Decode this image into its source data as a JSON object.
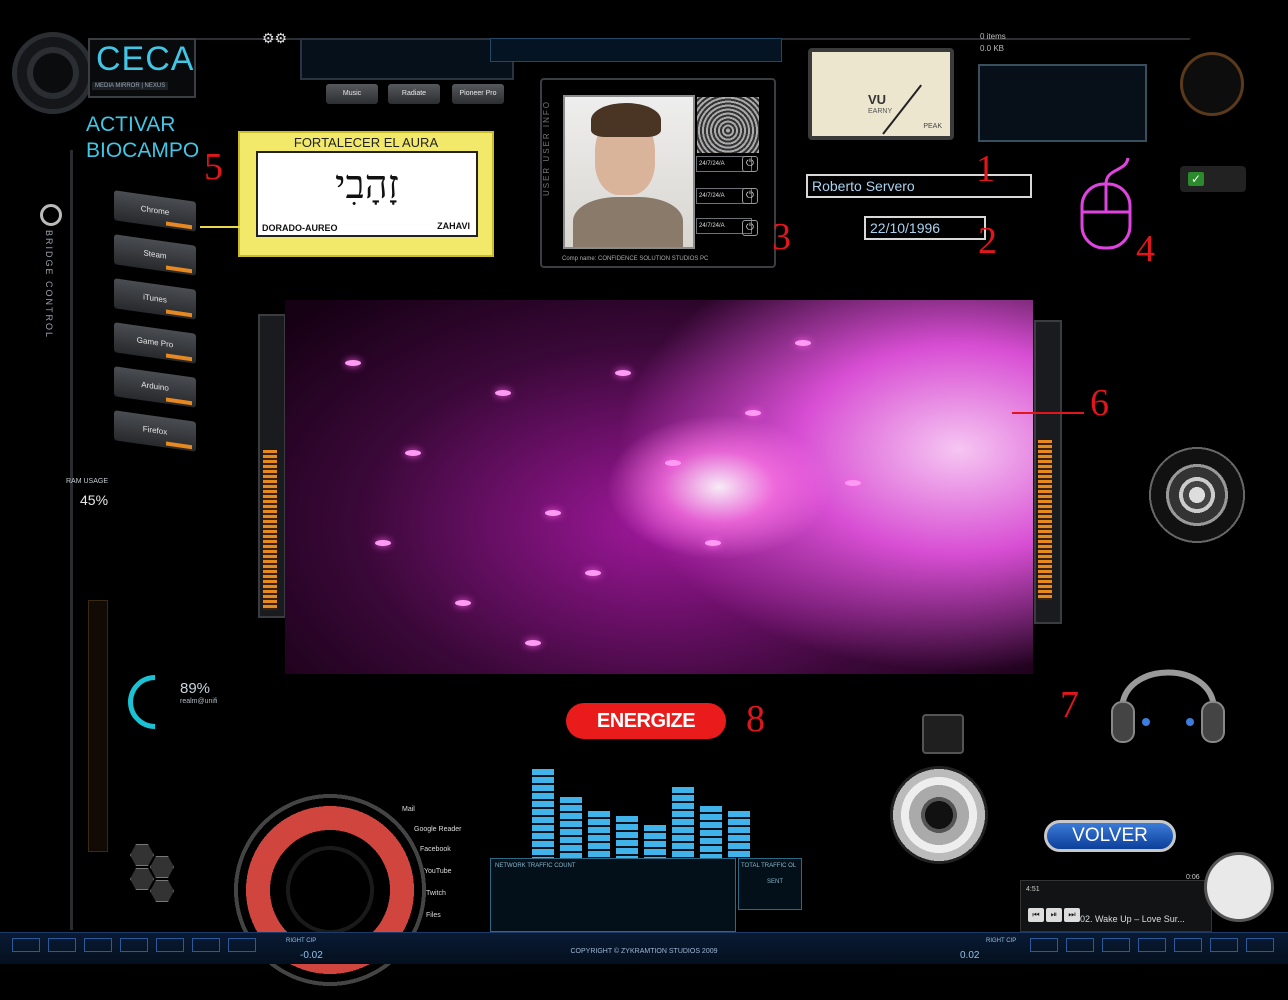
{
  "logo": {
    "title": "CECA",
    "subtitle": "MEDIA MIRROR | NEXUS"
  },
  "activar": {
    "line1": "ACTIVAR",
    "line2": "BIOCAMPO"
  },
  "top_tabs": [
    "Music",
    "Radiate",
    "Pioneer Pro"
  ],
  "launcher": [
    "Chrome",
    "Steam",
    "iTunes",
    "Game Pro",
    "Arduino",
    "Firefox"
  ],
  "left_panel": {
    "bridge": "BRIDGE CONTROL",
    "ram_label": "RAM USAGE",
    "ram_value": "45%",
    "gauge_value": "89%",
    "gauge_sub": "realm@unifi"
  },
  "aura_card": {
    "title": "FORTALECER EL AURA",
    "hebrew": "זָהָבִי",
    "left": "DORADO-AUREO",
    "right": "ZAHAVI"
  },
  "profile": {
    "caption": "Comp name: CONFIDENCE SOLUTION STUDIOS PC",
    "slots": [
      "24/7/24/A",
      "24/7/24/A",
      "24/7/24/A"
    ],
    "side_text": "USER USER INFO"
  },
  "vu_meter": {
    "label": "VU",
    "brand": "EARNY",
    "peak": "PEAK"
  },
  "sysinfo": {
    "items": "0 items",
    "size": "0.0 KB"
  },
  "form": {
    "name_value": "Roberto Servero",
    "date_value": "22/10/1996"
  },
  "markers": [
    "1",
    "2",
    "3",
    "4",
    "5",
    "6",
    "7",
    "8"
  ],
  "energize_label": "ENERGIZE",
  "volver_label": "VOLVER",
  "eq_levels": [
    0.95,
    0.65,
    0.5,
    0.45,
    0.35,
    0.75,
    0.55,
    0.5
  ],
  "traffic": {
    "label1": "NETWORK TRAFFIC COUNT",
    "label2": "TOTAL TRAFFIC OL",
    "label3": "SENT"
  },
  "radial_menu": [
    "Mail",
    "Google Reader",
    "Facebook",
    "YouTube",
    "Twitch",
    "Files"
  ],
  "player": {
    "track": "02. Wake Up – Love Sur...",
    "time_start": "4:51",
    "time_end": "0:06"
  },
  "bottom_bar": {
    "copyright": "COPYRIGHT © ZYKRAMTION STUDIOS 2009",
    "left_label": "RIGHT CIP",
    "left_value": "-0.02",
    "right_label": "RIGHT CIP",
    "right_value": "0.02"
  },
  "colors": {
    "accent_cyan": "#41c6e6",
    "marker_red": "#e0161c",
    "energize_red": "#ea1b1b",
    "volver_blue": "#1f5fc0",
    "aura_yellow": "#f2e96a"
  }
}
